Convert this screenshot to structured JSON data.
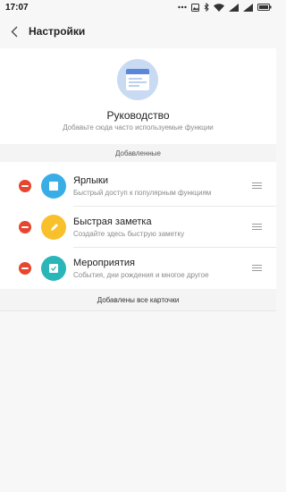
{
  "status_bar": {
    "time": "17:07"
  },
  "header": {
    "title": "Настройки"
  },
  "guide": {
    "title": "Руководство",
    "subtitle": "Добавьте сюда часто используемые функции"
  },
  "section": {
    "added_label": "Добавленные"
  },
  "items": [
    {
      "label": "Ярлыки",
      "desc": "Быстрый доступ к популярным функциям",
      "icon": "shortcuts-icon",
      "color": "#39aee6"
    },
    {
      "label": "Быстрая заметка",
      "desc": "Создайте здесь быструю заметку",
      "icon": "pencil-icon",
      "color": "#f8c02a"
    },
    {
      "label": "Мероприятия",
      "desc": "События, дни рождения и многое другое",
      "icon": "calendar-check-icon",
      "color": "#2ab5b9"
    }
  ],
  "footer": {
    "text": "Добавлены все карточки"
  },
  "colors": {
    "remove": "#e8452e",
    "guide_icon_bg": "#c9daf3"
  }
}
